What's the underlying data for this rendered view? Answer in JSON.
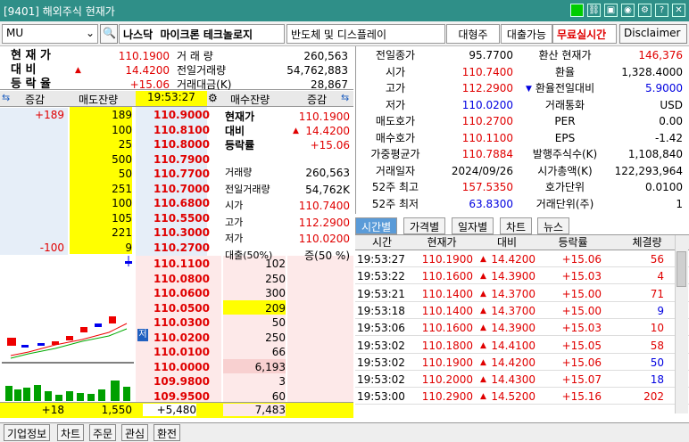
{
  "window": {
    "title": "[9401] 해외주식 현재가"
  },
  "toolbar": {
    "symbol": "MU",
    "market": "나스닥",
    "name": "마이크론 테크놀로지",
    "sector": "반도체 및 디스플레이",
    "size": "대형주",
    "loan": "대출가능",
    "realtime": "무료실시간",
    "disclaimer": "Disclaimer"
  },
  "summary": {
    "rows": [
      {
        "label": "현 재 가",
        "value": "110.1900",
        "label2": "거 래 량",
        "value2": "260,563"
      },
      {
        "label": "대    비",
        "value": "14.4200",
        "label2": "전일거래량",
        "value2": "54,762,883"
      },
      {
        "label": "등 락 율",
        "value": "+15.06",
        "label2": "거래대금(K)",
        "value2": "28,867"
      }
    ]
  },
  "info": {
    "rows": [
      {
        "l": "전일종가",
        "v": "95.7700",
        "l2": "환산 현재가",
        "v2": "146,376"
      },
      {
        "l": "시가",
        "v": "110.7400",
        "l2": "환율",
        "v2": "1,328.4000"
      },
      {
        "l": "고가",
        "v": "112.2900",
        "l2": "환율전일대비",
        "v2": "5.9000"
      },
      {
        "l": "저가",
        "v": "110.0200",
        "l2": "거래통화",
        "v2": "USD"
      },
      {
        "l": "매도호가",
        "v": "110.2700",
        "l2": "PER",
        "v2": "0.00"
      },
      {
        "l": "매수호가",
        "v": "110.1100",
        "l2": "EPS",
        "v2": "-1.42"
      },
      {
        "l": "가중평균가",
        "v": "110.7884",
        "l2": "발행주식수(K)",
        "v2": "1,108,840"
      },
      {
        "l": "거래일자",
        "v": "2024/09/26",
        "l2": "시가총액(K)",
        "v2": "122,293,964"
      },
      {
        "l": "52주 최고",
        "v": "157.5350",
        "l2": "호가단위",
        "v2": "0.0100"
      },
      {
        "l": "52주 최저",
        "v": "63.8300",
        "l2": "거래단위(주)",
        "v2": "1"
      }
    ]
  },
  "orderbook": {
    "headers": {
      "change": "증감",
      "ask_qty": "매도잔량",
      "time": "19:53:27",
      "bid_qty": "매수잔량",
      "change2": "증감"
    },
    "asks": [
      {
        "chg": "+189",
        "qty": "189",
        "price": "110.9000"
      },
      {
        "chg": "",
        "qty": "100",
        "price": "110.8100"
      },
      {
        "chg": "",
        "qty": "25",
        "price": "110.8000"
      },
      {
        "chg": "",
        "qty": "500",
        "price": "110.7900"
      },
      {
        "chg": "",
        "qty": "50",
        "price": "110.7700"
      },
      {
        "chg": "",
        "qty": "251",
        "price": "110.7000"
      },
      {
        "chg": "",
        "qty": "100",
        "price": "110.6800"
      },
      {
        "chg": "",
        "qty": "105",
        "price": "110.5500"
      },
      {
        "chg": "",
        "qty": "221",
        "price": "110.3000"
      },
      {
        "chg": "-100",
        "qty": "9",
        "price": "110.2700"
      }
    ],
    "bids": [
      {
        "price": "110.1100",
        "qty": "102"
      },
      {
        "price": "110.0800",
        "qty": "250"
      },
      {
        "price": "110.0600",
        "qty": "300"
      },
      {
        "price": "110.0500",
        "qty": "209"
      },
      {
        "price": "110.0300",
        "qty": "50"
      },
      {
        "price": "110.0200",
        "qty": "250"
      },
      {
        "price": "110.0100",
        "qty": "66"
      },
      {
        "price": "110.0000",
        "qty": "6,193"
      },
      {
        "price": "109.9800",
        "qty": "3"
      },
      {
        "price": "109.9500",
        "qty": "60"
      }
    ],
    "side": {
      "cur_label": "현재가",
      "cur": "110.1900",
      "diff_label": "대비",
      "diff": "14.4200",
      "rate_label": "등락률",
      "rate": "+15.06",
      "rows": [
        {
          "l": "거래량",
          "v": "260,563"
        },
        {
          "l": "전일거래량",
          "v": "54,762K"
        },
        {
          "l": "시가",
          "v": "110.7400"
        },
        {
          "l": "고가",
          "v": "112.2900"
        },
        {
          "l": "저가",
          "v": "110.0200"
        },
        {
          "l": "대출(50%)",
          "v": "증(50 %)"
        }
      ]
    },
    "low_marker": "저",
    "footer": {
      "chg": "+18",
      "ask_total": "1,550",
      "bid_chg": "+5,480",
      "bid_total": "7,483"
    }
  },
  "tabs": [
    "시간별",
    "가격별",
    "일자별",
    "차트",
    "뉴스"
  ],
  "trades": {
    "headers": [
      "시간",
      "현재가",
      "대비",
      "등락률",
      "체결량"
    ],
    "rows": [
      {
        "time": "19:53:27",
        "price": "110.1900",
        "diff": "14.4200",
        "rate": "+15.06",
        "vol": "56",
        "vc": "red"
      },
      {
        "time": "19:53:22",
        "price": "110.1600",
        "diff": "14.3900",
        "rate": "+15.03",
        "vol": "4",
        "vc": "red"
      },
      {
        "time": "19:53:21",
        "price": "110.1400",
        "diff": "14.3700",
        "rate": "+15.00",
        "vol": "71",
        "vc": "red"
      },
      {
        "time": "19:53:18",
        "price": "110.1400",
        "diff": "14.3700",
        "rate": "+15.00",
        "vol": "9",
        "vc": "blue"
      },
      {
        "time": "19:53:06",
        "price": "110.1600",
        "diff": "14.3900",
        "rate": "+15.03",
        "vol": "10",
        "vc": "red"
      },
      {
        "time": "19:53:02",
        "price": "110.1800",
        "diff": "14.4100",
        "rate": "+15.05",
        "vol": "58",
        "vc": "red"
      },
      {
        "time": "19:53:02",
        "price": "110.1900",
        "diff": "14.4200",
        "rate": "+15.06",
        "vol": "50",
        "vc": "blue"
      },
      {
        "time": "19:53:02",
        "price": "110.2000",
        "diff": "14.4300",
        "rate": "+15.07",
        "vol": "18",
        "vc": "blue"
      },
      {
        "time": "19:53:00",
        "price": "110.2900",
        "diff": "14.5200",
        "rate": "+15.16",
        "vol": "202",
        "vc": "red"
      }
    ]
  },
  "bottom_tabs": [
    "기업정보",
    "차트",
    "주문",
    "관심",
    "환전"
  ],
  "colors": {
    "title_bg": "#2f8f88",
    "ask_bg": "#e6eef8",
    "bid_bg": "#fde9e9",
    "yellow": "#ffff00",
    "green": "#00a000"
  }
}
